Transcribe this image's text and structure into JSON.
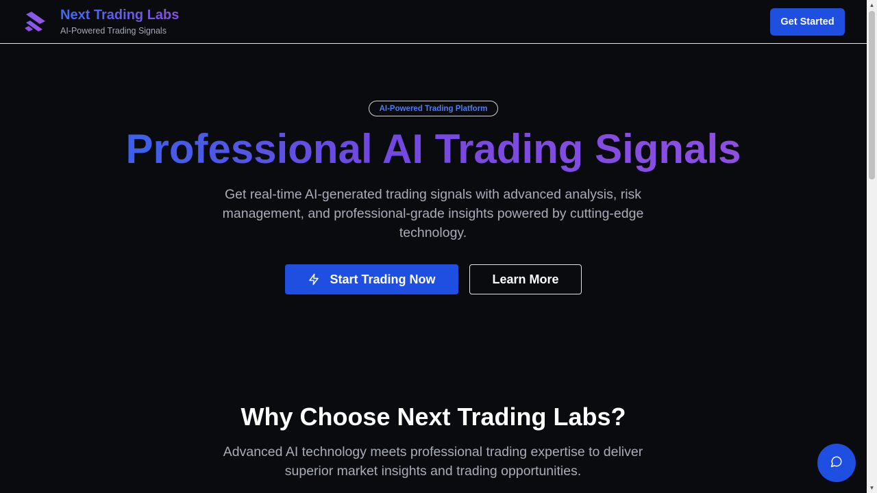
{
  "header": {
    "brand_title": "Next Trading Labs",
    "brand_subtitle": "AI-Powered Trading Signals",
    "cta_label": "Get Started",
    "logo_icon": "diagonal-stripes-logo"
  },
  "hero": {
    "badge": "AI-Powered Trading Platform",
    "title": "Professional AI Trading Signals",
    "description": "Get real-time AI-generated trading signals with advanced analysis, risk management, and professional-grade insights powered by cutting-edge technology.",
    "primary_button": "Start Trading Now",
    "primary_button_icon": "lightning-bolt-icon",
    "secondary_button": "Learn More"
  },
  "why": {
    "title": "Why Choose Next Trading Labs?",
    "description": "Advanced AI technology meets professional trading expertise to deliver superior market insights and trading opportunities."
  },
  "chat": {
    "icon": "chat-bubble-icon"
  },
  "colors": {
    "background": "#0a0b0f",
    "accent_blue": "#1f4fe0",
    "gradient_start": "#3b61ea",
    "gradient_end": "#8e4fe2",
    "muted_text": "#a8adb8"
  }
}
